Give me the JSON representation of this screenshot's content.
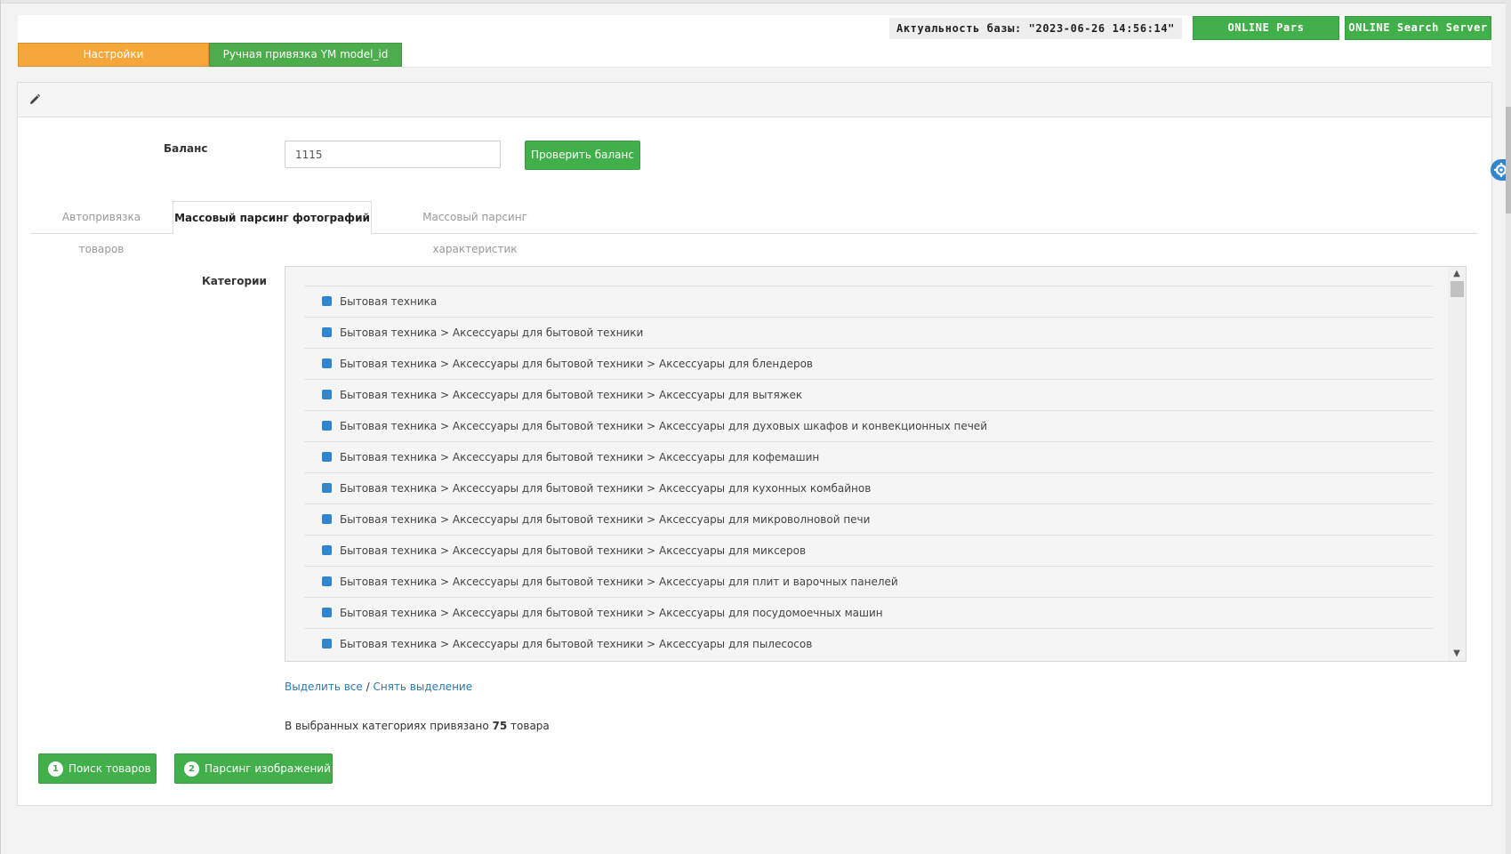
{
  "header": {
    "db_actuality": "Актуальность базы: \"2023-06-26 14:56:14\"",
    "status_buttons": [
      "ONLINE Pars",
      "ONLINE Search Server"
    ],
    "menu_tabs": [
      "Настройки",
      "Ручная привязка YM model_id"
    ]
  },
  "balance": {
    "label": "Баланс",
    "value": "1115",
    "check_button": "Проверить баланс"
  },
  "tabs": [
    "Автопривязка товаров",
    "Массовый парсинг фотографий",
    "Массовый парсинг характеристик"
  ],
  "active_tab": "Массовый парсинг фотографий",
  "categories": {
    "label": "Категории",
    "items": [
      "Бытовая техника",
      "Бытовая техника > Аксессуары для бытовой техники",
      "Бытовая техника > Аксессуары для бытовой техники > Аксессуары для блендеров",
      "Бытовая техника > Аксессуары для бытовой техники > Аксессуары для вытяжек",
      "Бытовая техника > Аксессуары для бытовой техники > Аксессуары для духовых шкафов и конвекционных печей",
      "Бытовая техника > Аксессуары для бытовой техники > Аксессуары для кофемашин",
      "Бытовая техника > Аксессуары для бытовой техники > Аксессуары для кухонных комбайнов",
      "Бытовая техника > Аксессуары для бытовой техники > Аксессуары для микроволновой печи",
      "Бытовая техника > Аксессуары для бытовой техники > Аксессуары для миксеров",
      "Бытовая техника > Аксессуары для бытовой техники > Аксессуары для плит и варочных панелей",
      "Бытовая техника > Аксессуары для бытовой техники > Аксессуары для посудомоечных машин",
      "Бытовая техника > Аксессуары для бытовой техники > Аксессуары для пылесосов"
    ]
  },
  "select_links": {
    "select_all": "Выделить все",
    "separator": " / ",
    "deselect": "Снять выделение"
  },
  "bound_info": {
    "prefix": "В выбранных категориях привязано ",
    "count": "75",
    "suffix": " товара"
  },
  "actions": [
    {
      "num": "1",
      "label": "Поиск товаров"
    },
    {
      "num": "2",
      "label": "Парсинг изображений"
    }
  ]
}
